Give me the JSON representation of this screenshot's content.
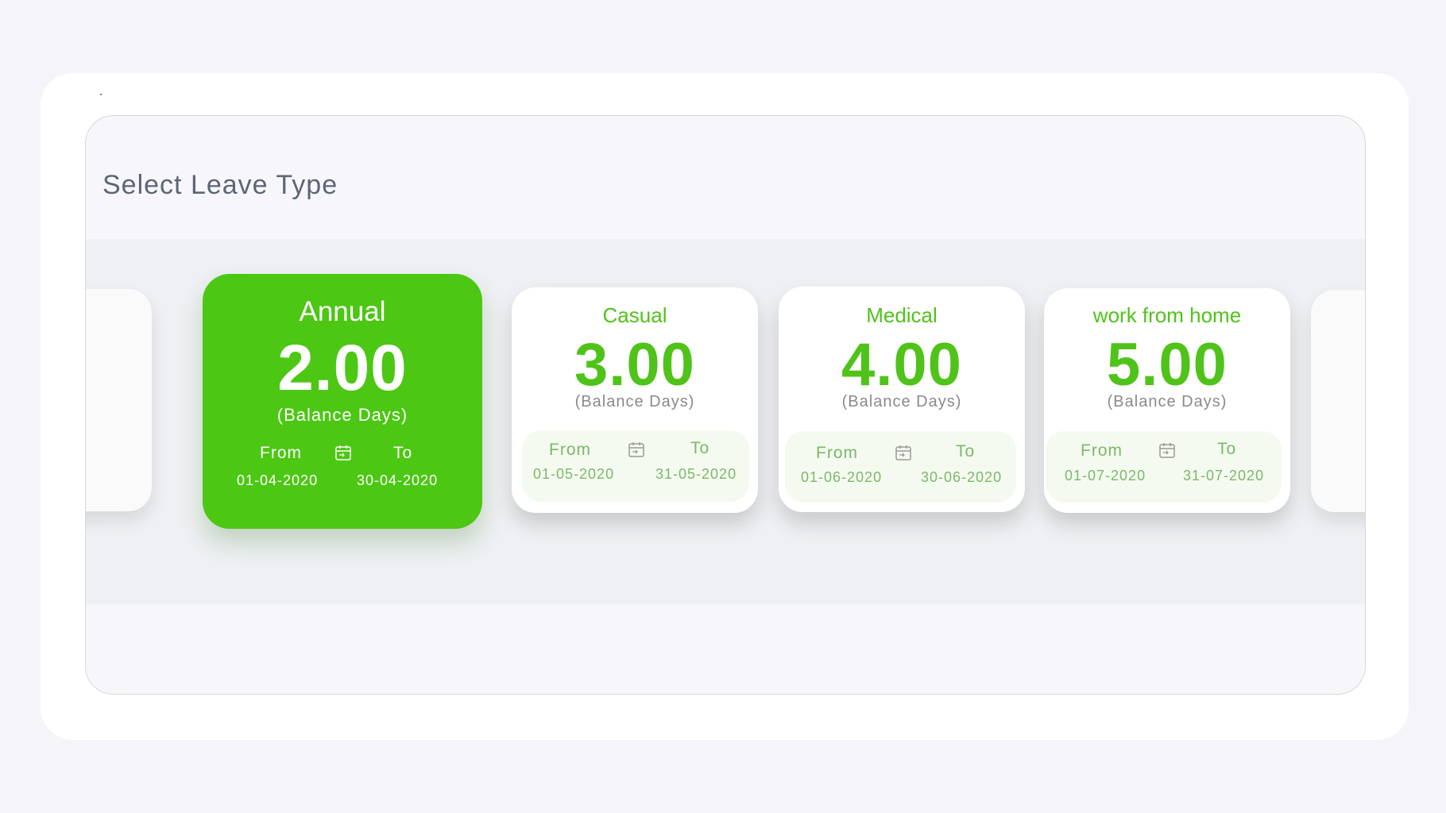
{
  "page": {
    "title": "Select Leave Type"
  },
  "cards": [
    {
      "name": "Annual",
      "balance": "2.00",
      "caption": "(Balance Days)",
      "from_label": "From",
      "to_label": "To",
      "from_date": "01-04-2020",
      "to_date": "30-04-2020",
      "selected": true
    },
    {
      "name": "Casual",
      "balance": "3.00",
      "caption": "(Balance Days)",
      "from_label": "From",
      "to_label": "To",
      "from_date": "01-05-2020",
      "to_date": "31-05-2020",
      "selected": false
    },
    {
      "name": "Medical",
      "balance": "4.00",
      "caption": "(Balance Days)",
      "from_label": "From",
      "to_label": "To",
      "from_date": "01-06-2020",
      "to_date": "30-06-2020",
      "selected": false
    },
    {
      "name": "work from home",
      "balance": "5.00",
      "caption": "(Balance Days)",
      "from_label": "From",
      "to_label": "To",
      "from_date": "01-07-2020",
      "to_date": "31-07-2020",
      "selected": false
    }
  ],
  "icons": {
    "date_range": "calendar-icon"
  },
  "colors": {
    "accent": "#4cc713",
    "accent_text": "#4fc319",
    "date_text": "#7cb86a",
    "title_text": "#5d6577",
    "background": "#f4f4f9"
  }
}
